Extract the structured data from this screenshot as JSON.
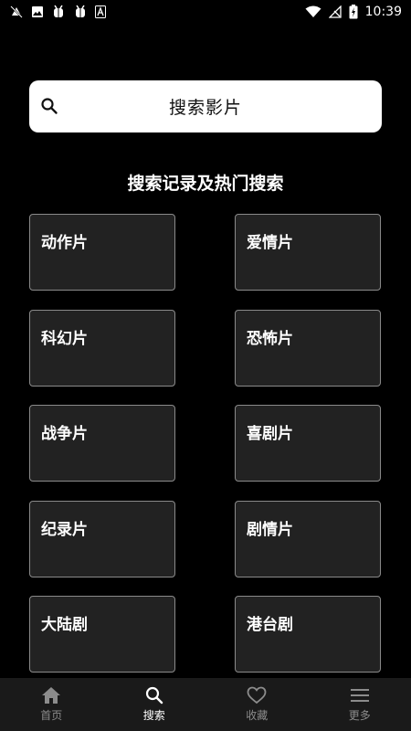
{
  "status_bar": {
    "time": "10:39",
    "left_icons": [
      "muted-bell-icon",
      "image-icon",
      "bug-icon",
      "bug-icon",
      "text-badge-icon"
    ],
    "right_icons": [
      "wifi-icon",
      "no-signal-icon",
      "battery-charging-icon"
    ]
  },
  "search": {
    "placeholder": "搜索影片"
  },
  "section": {
    "title": "搜索记录及热门搜索"
  },
  "categories": [
    {
      "label": "动作片"
    },
    {
      "label": "爱情片"
    },
    {
      "label": "科幻片"
    },
    {
      "label": "恐怖片"
    },
    {
      "label": "战争片"
    },
    {
      "label": "喜剧片"
    },
    {
      "label": "纪录片"
    },
    {
      "label": "剧情片"
    },
    {
      "label": "大陆剧"
    },
    {
      "label": "港台剧"
    }
  ],
  "bottom_nav": {
    "items": [
      {
        "label": "首页",
        "icon": "home-icon",
        "active": false
      },
      {
        "label": "搜索",
        "icon": "search-icon",
        "active": true
      },
      {
        "label": "收藏",
        "icon": "heart-icon",
        "active": false
      },
      {
        "label": "更多",
        "icon": "menu-icon",
        "active": false
      }
    ]
  },
  "colors": {
    "background": "#000000",
    "search_bar": "#ffffff",
    "card_background": "#222222",
    "card_border": "#8a8a8a",
    "nav_background": "#1a1a1a",
    "nav_inactive": "#8c8c8c",
    "nav_active": "#ffffff"
  }
}
